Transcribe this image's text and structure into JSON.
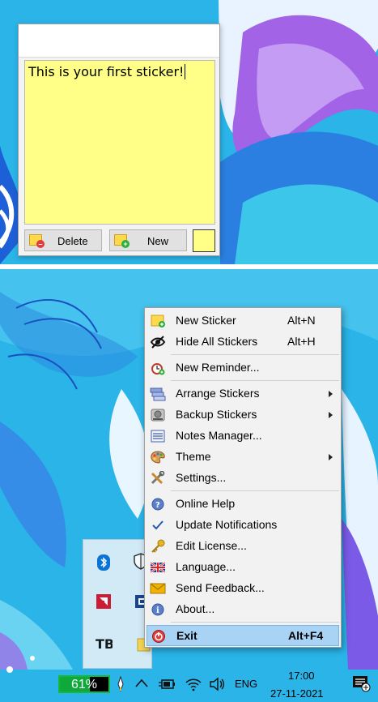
{
  "sticker": {
    "text": "This is your first sticker!",
    "delete_label": "Delete",
    "new_label": "New",
    "note_color": "#ffff88"
  },
  "menu": {
    "items": [
      {
        "label": "New Sticker",
        "shortcut": "Alt+N",
        "icon": "sticker-add-icon"
      },
      {
        "label": "Hide All Stickers",
        "shortcut": "Alt+H",
        "icon": "eye-hidden-icon"
      },
      {
        "label": "New Reminder...",
        "icon": "alarm-clock-icon"
      },
      {
        "label": "Arrange Stickers",
        "submenu": true,
        "icon": "arrange-icon"
      },
      {
        "label": "Backup Stickers",
        "submenu": true,
        "icon": "backup-drive-icon"
      },
      {
        "label": "Notes Manager...",
        "icon": "notes-list-icon"
      },
      {
        "label": "Theme",
        "submenu": true,
        "icon": "palette-icon"
      },
      {
        "label": "Settings...",
        "icon": "tools-icon"
      },
      {
        "label": "Online Help",
        "icon": "help-icon"
      },
      {
        "label": "Update Notifications",
        "checked": true,
        "icon": "checkmark-icon"
      },
      {
        "label": "Edit License...",
        "icon": "key-icon"
      },
      {
        "label": "Language...",
        "icon": "uk-flag-icon"
      },
      {
        "label": "Send Feedback...",
        "icon": "envelope-icon"
      },
      {
        "label": "About...",
        "icon": "info-icon"
      },
      {
        "label": "Exit",
        "shortcut": "Alt+F4",
        "highlighted": true,
        "icon": "power-icon"
      }
    ]
  },
  "taskbar": {
    "battery_percent": "61%",
    "battery_level": 0.61,
    "language": "ENG",
    "time": "17:00",
    "date": "27-11-2021"
  },
  "colors": {
    "menu_highlight": "#a9d3f5",
    "battery_green": "#0fa83a",
    "wallpaper_blue": "#2ab4e8",
    "wallpaper_purple": "#9b4fe0"
  }
}
